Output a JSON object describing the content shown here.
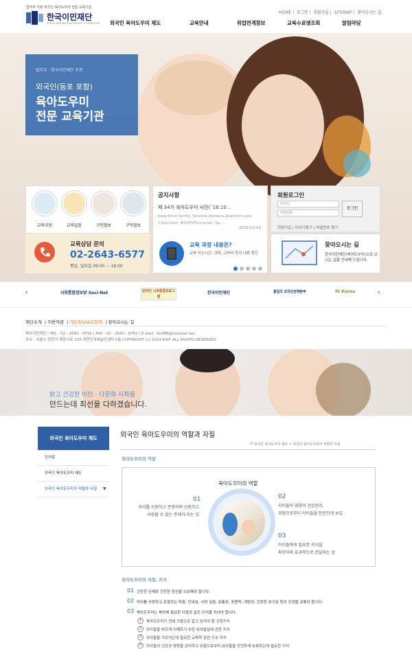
{
  "header": {
    "tagline": "법무부 지정 외국인 육아도우미 전문 교육기관",
    "logo_kr": "한국이민재단",
    "logo_en": "KOREA IMMIGRATION SERVICE FOUNDATION",
    "util_links": [
      "HOME",
      "로그인",
      "회원가입",
      "SITEMAP",
      "찾아오시는 길"
    ],
    "nav": [
      "외국인 육아도우미 제도",
      "교육안내",
      "취업연계정보",
      "교육수료생조회",
      "알림마당"
    ]
  },
  "hero": {
    "sub": "법무부 · 한국이민재단 주관",
    "line1": "외국인(동포 포함)",
    "line2": "육아도우미",
    "line3": "전문 교육기관"
  },
  "quick": {
    "items": [
      "교육과정",
      "교육일정",
      "구인정보",
      "구직정보"
    ],
    "consult_title": "교육상담 문의",
    "consult_phone": "02-2643-6577",
    "consult_hours": "평일, 일요일  09:00 ~ 18:00"
  },
  "notice": {
    "title": "공지사항",
    "item": "제 34기 육아도우미 사진(`16.10...",
    "snippet": "body{font-family: Tahoma,Verdana,Arial;font-size: 11px;color: #555555;margin: 0p...",
    "date": "2016-11-14",
    "course_title": "교육 과정 내용은?",
    "course_desc": "교육 이수시간, 과목, 교육비 등의 내용 확인"
  },
  "login": {
    "title": "회원로그인",
    "id_placeholder": "아이디",
    "pw_placeholder": "비밀번호",
    "button": "로그인",
    "links": [
      "회원가입",
      "아이디찾기",
      "비밀번호 찾기"
    ],
    "map_title": "찾아오시는 길",
    "map_desc": "한국이민재단(육아도우미)으로 오시는 길을 안내해 드립니다."
  },
  "partners": [
    "사회통합정보망 Soci-Net",
    "온라인 시회통합프로그램",
    "한국이민재단",
    "출입국 외국인정책본부",
    "Hi Korea"
  ],
  "footer": {
    "links": [
      "재단소개",
      "이용약관",
      "개인정보보호정책",
      "찾아오시는 길"
    ],
    "info1": "육아이민재단   |   TEL : 02 - 2643 - 8791   |   FAX : 02 - 2643 - 8792   |   E-mail : kisf88@hanmail.net",
    "info2": "주소 : 서울시 양천구 목동서로 225 대한민국예술인센터 5층 COPYRIGHT (c) 2014 KISF. ALL RIGHTS RESERVED."
  },
  "banner2": {
    "line1": "밝고 건강한 이민 · 다문화 사회를",
    "line2": "만드는데 최선을 다하겠습니다."
  },
  "content": {
    "snb_title": "외국인 육아도우미 제도",
    "snb_items": [
      "인사말",
      "외국인 육아도우미 제도",
      "외국인 육아도우미의 역할과 자질"
    ],
    "page_title": "외국인 육아도우미의 역할과 자질",
    "breadcrumb": "외국인 육아도우미 제도  >  외국인 육아도우미의 역할과 자질",
    "role_heading": "육아도우미의 역할",
    "role_center": "육아도우미의 역할",
    "roles": [
      {
        "num": "01",
        "l1": "아이를 사랑하고 존중하며 신뢰하고",
        "l2": "사랑할 수 있는 존재가 되는 것"
      },
      {
        "num": "02",
        "l1": "아이들의 영양과 건강관리,",
        "l2": "위험으로부터 아이들을 안전하게 보호"
      },
      {
        "num": "03",
        "l1": "아이들에게 필요한 지식을",
        "l2": "파악하여 효과적으로 전달하는 것"
      }
    ],
    "qual_heading": "육아도우미의 자질, 지식",
    "quals": [
      {
        "num": "01",
        "text": "건강한 신체와 건전한 정신을 소유해야 합니다."
      },
      {
        "num": "02",
        "text": "아이를 사랑하고 존중하는 마음, 인내심, 사려 깊음, 유통성, 포용력, 개방성, 건강한 호기심 등의 인성을 갖춰야 합니다."
      },
      {
        "num": "03",
        "text": "육아도우미는 육아에 필요한 다음과 같은 지식을 지녀야 합니다."
      }
    ],
    "subquals": [
      "육아도우미가 전에 지켰으로 알고 있어야 할 규정지식",
      "아이들을 바르게 이해하기 위한 유아발달에 관한 지식",
      "아이들을 가르치는데 필요한 교육학 관련 기초 지식",
      "아이들의 건강과 영양을 관리하고 위험으로부터 유아들을 안전하게 보호하는데 필요한 지식"
    ]
  },
  "colors": {
    "brand": "#2f5fa4",
    "accent_phone": "#2b6fc6",
    "hero_box": "#3d6fb0"
  }
}
